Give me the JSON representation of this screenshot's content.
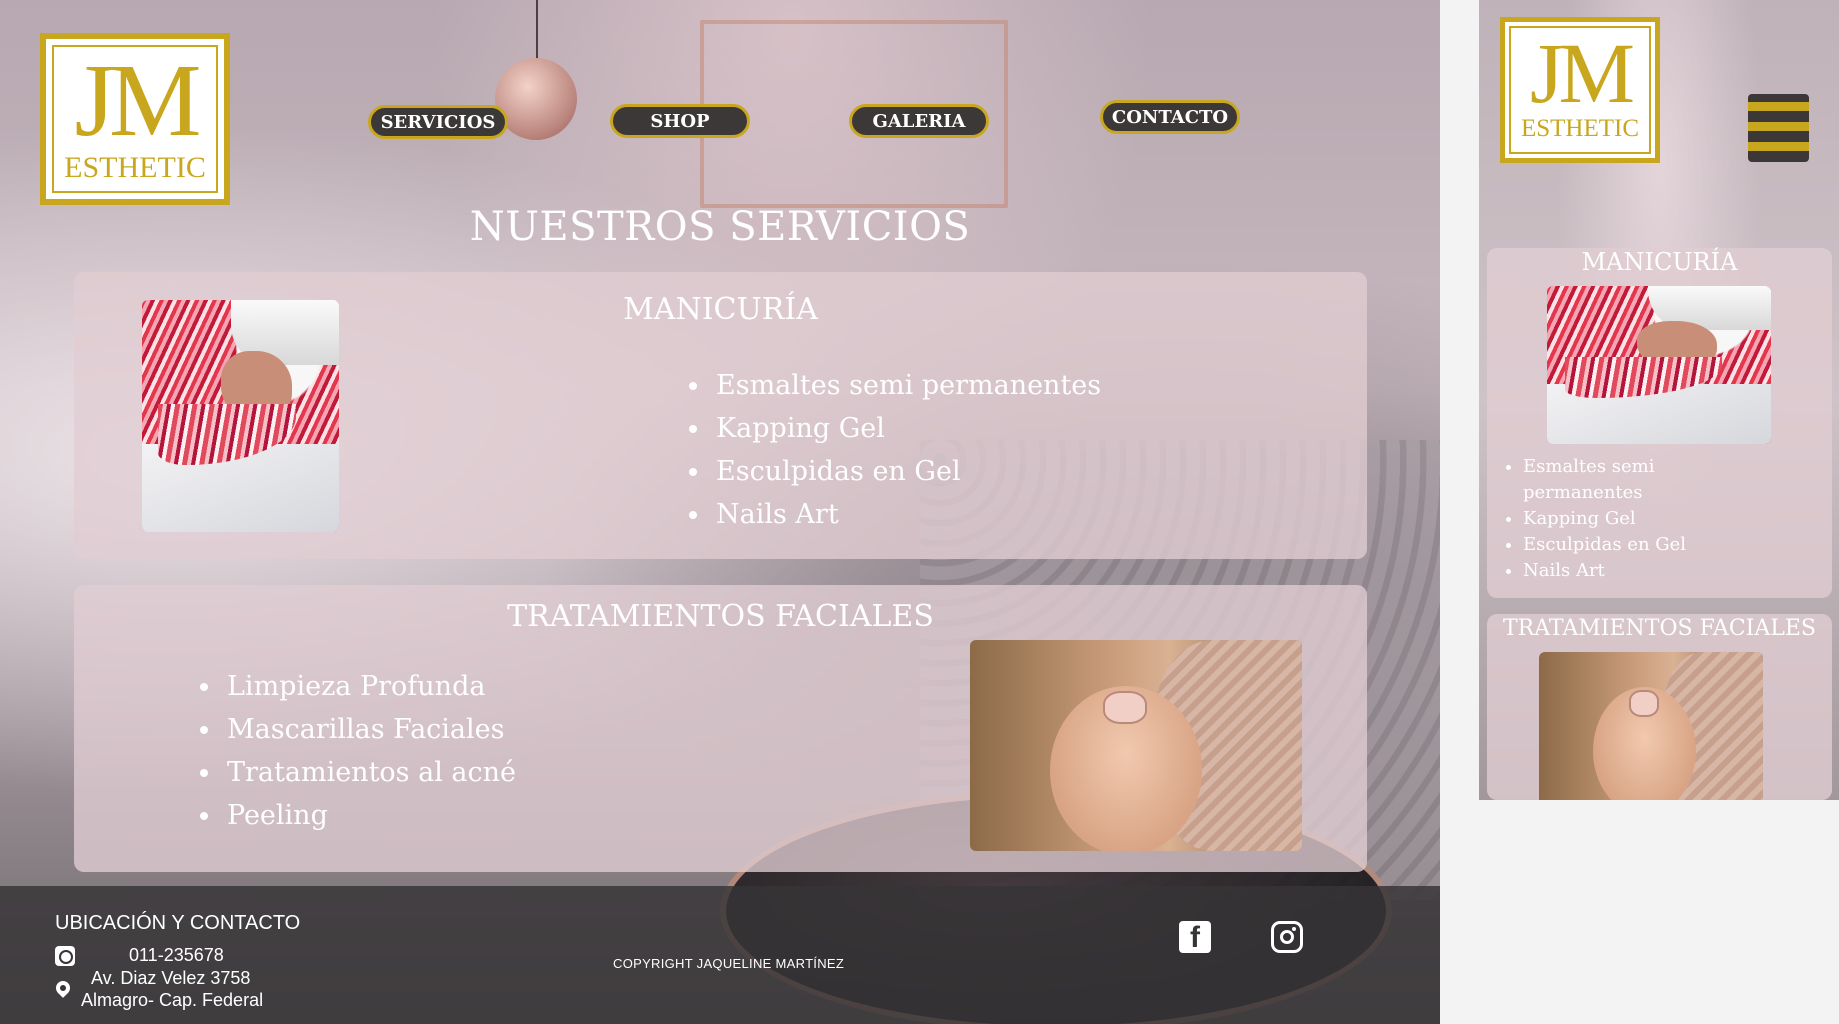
{
  "brand": {
    "logo_initials": "JM",
    "logo_sub": "ESTHETIC",
    "accent": "#c8a71e",
    "button_bg": "#3c3838"
  },
  "nav": [
    {
      "label": "SERVICIOS"
    },
    {
      "label": "SHOP"
    },
    {
      "label": "GALERIA"
    },
    {
      "label": "CONTACTO"
    }
  ],
  "page": {
    "title": "NUESTROS SERVICIOS"
  },
  "services": [
    {
      "title": "MANICURÍA",
      "image_icon": "nails-photo",
      "items": [
        "Esmaltes semi permanentes",
        "Kapping Gel",
        "Esculpidas en Gel",
        "Nails Art"
      ]
    },
    {
      "title": "TRATAMIENTOS FACIALES",
      "image_icon": "facial-photo",
      "items": [
        "Limpieza Profunda",
        "Mascarillas Faciales",
        "Tratamientos al acné",
        "Peeling"
      ]
    }
  ],
  "footer": {
    "title": "UBICACIÓN Y CONTACTO",
    "phone": "011-235678",
    "address_line1": "Av. Diaz Velez 3758",
    "address_line2": "Almagro- Cap. Federal",
    "copyright": "COPYRIGHT JAQUELINE MARTÍNEZ",
    "social": [
      "facebook-icon",
      "instagram-icon"
    ]
  },
  "mobile": {
    "menu_icon": "hamburger-icon"
  }
}
